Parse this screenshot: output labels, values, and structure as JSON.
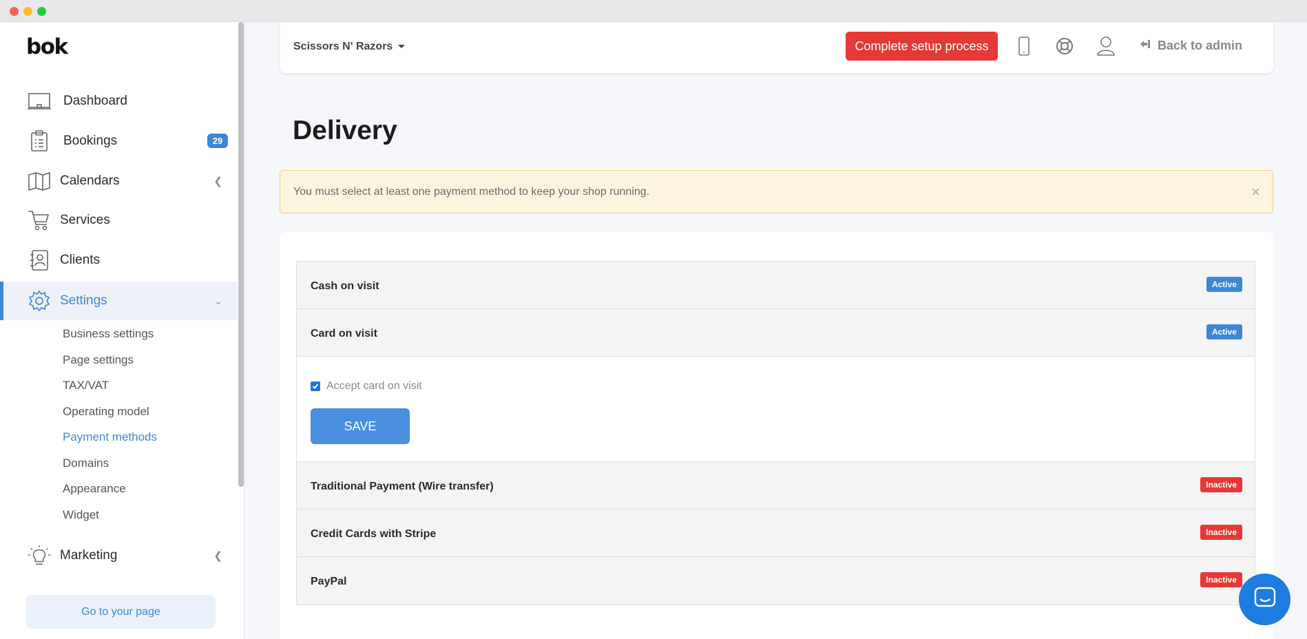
{
  "app": {
    "logo": "bok"
  },
  "sidebar": {
    "items": [
      {
        "label": "Dashboard",
        "icon": "dashboard-icon"
      },
      {
        "label": "Bookings",
        "icon": "clipboard-icon",
        "badge": "29"
      },
      {
        "label": "Calendars",
        "icon": "map-icon"
      },
      {
        "label": "Services",
        "icon": "cart-icon"
      },
      {
        "label": "Clients",
        "icon": "contact-icon"
      },
      {
        "label": "Settings",
        "icon": "gear-icon"
      },
      {
        "label": "Marketing",
        "icon": "lightbulb-icon"
      }
    ],
    "settings_sub": [
      "Business settings",
      "Page settings",
      "TAX/VAT",
      "Operating model",
      "Payment methods",
      "Domains",
      "Appearance",
      "Widget"
    ],
    "current_sub": "Payment methods",
    "go_page_label": "Go to your page"
  },
  "topbar": {
    "shop_name": "Scissors N' Razors",
    "setup_label": "Complete setup process",
    "back_label": "Back to admin"
  },
  "page": {
    "title": "Delivery",
    "alert": "You must select at least one payment method to keep your shop running.",
    "alert_close": "×"
  },
  "methods": [
    {
      "name": "Cash on visit",
      "status": "Active"
    },
    {
      "name": "Card on visit",
      "status": "Active"
    },
    {
      "name": "Traditional Payment (Wire transfer)",
      "status": "Inactive"
    },
    {
      "name": "Credit Cards with Stripe",
      "status": "Inactive"
    },
    {
      "name": "PayPal",
      "status": "Inactive"
    }
  ],
  "card_on_visit": {
    "checkbox_label": "Accept card on visit",
    "checked": true,
    "save_label": "SAVE"
  },
  "colors": {
    "accent": "#3f86d6",
    "danger": "#e53935",
    "alert_bg": "#fdf4df"
  }
}
